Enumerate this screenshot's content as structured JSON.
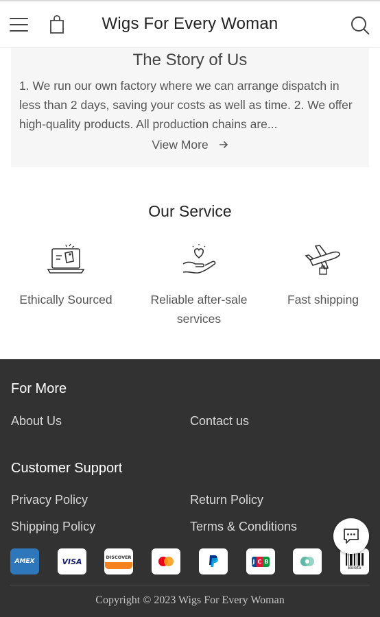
{
  "header": {
    "brand": "Wigs For Every Woman",
    "menu_icon": "hamburger-menu-icon",
    "cart_icon": "shopping-bag-icon",
    "search_icon": "search-icon"
  },
  "story": {
    "title": "The Story of Us",
    "text": "1. We run our own factory where we can arrange dispatch in less than 2 days, saving your costs as well as time. 2. We offer high-quality products. All production chains are...",
    "view_more": "View More",
    "arrow_icon": "arrow-right-icon"
  },
  "services": {
    "title": "Our Service",
    "items": [
      {
        "label": "Ethically Sourced",
        "icon": "laptop-tag-icon"
      },
      {
        "label": "Reliable after-sale services",
        "icon": "hand-heart-icon"
      },
      {
        "label": "Fast shipping",
        "icon": "airplane-package-icon"
      }
    ]
  },
  "footer": {
    "for_more": {
      "heading": "For More",
      "links": [
        "About Us",
        "Contact us"
      ]
    },
    "support": {
      "heading": "Customer Support",
      "links": [
        "Privacy Policy",
        "Return Policy",
        "Shipping Policy",
        "Terms & Conditions"
      ]
    },
    "payments": [
      {
        "label": "AMEX",
        "icon": "amex-icon"
      },
      {
        "label": "VISA",
        "icon": "visa-icon"
      },
      {
        "label": "DISCOVER",
        "icon": "discover-icon"
      },
      {
        "label": "",
        "icon": "mastercard-icon"
      },
      {
        "label": "",
        "icon": "paypal-icon"
      },
      {
        "label": "JCB",
        "icon": "jcb-icon"
      },
      {
        "label": "",
        "icon": "diners-icon"
      },
      {
        "label": "Boleto",
        "icon": "boleto-icon"
      }
    ],
    "copyright": "Copyright © 2023 Wigs For Every Woman"
  },
  "chat": {
    "icon": "chat-bubble-icon"
  },
  "colors": {
    "footer_bg": "#323232",
    "story_bg": "#f6f6f6",
    "amex_blue": "#2e77bb",
    "visa_blue": "#1a1f71",
    "discover_orange": "#f58220",
    "mastercard_red": "#eb001b",
    "mastercard_yellow": "#f79e1b",
    "paypal_blue": "#003087",
    "jcb_green": "#009b3a",
    "diners_teal": "#5fb8a5"
  }
}
